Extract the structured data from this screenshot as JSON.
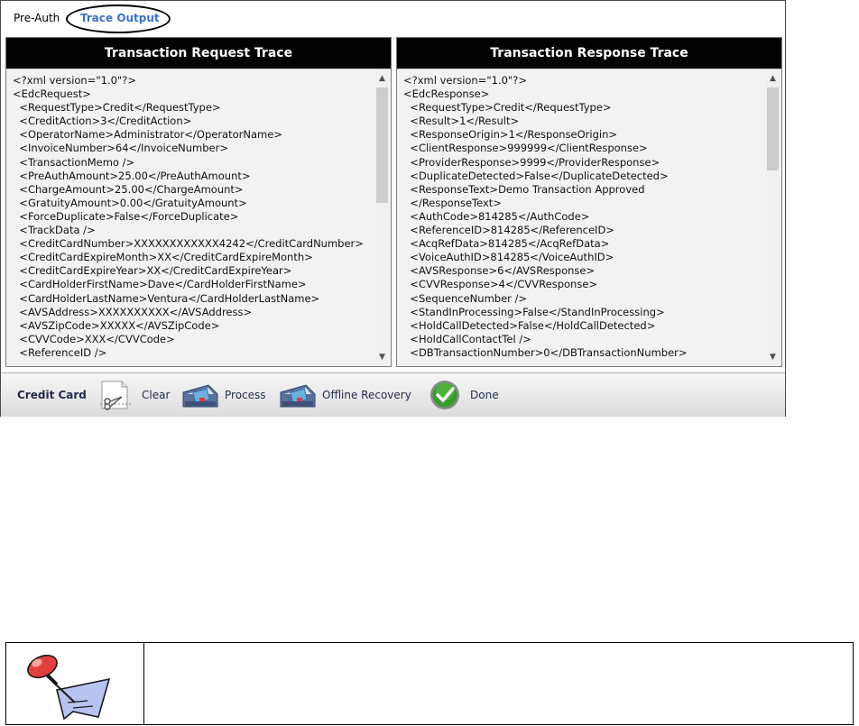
{
  "tabs": {
    "preauth": "Pre-Auth",
    "trace_output": "Trace Output"
  },
  "request_panel": {
    "title": "Transaction Request Trace",
    "text": "<?xml version=\"1.0\"?>\n<EdcRequest>\n  <RequestType>Credit</RequestType>\n  <CreditAction>3</CreditAction>\n  <OperatorName>Administrator</OperatorName>\n  <InvoiceNumber>64</InvoiceNumber>\n  <TransactionMemo />\n  <PreAuthAmount>25.00</PreAuthAmount>\n  <ChargeAmount>25.00</ChargeAmount>\n  <GratuityAmount>0.00</GratuityAmount>\n  <ForceDuplicate>False</ForceDuplicate>\n  <TrackData />\n  <CreditCardNumber>XXXXXXXXXXXX4242</CreditCardNumber>\n  <CreditCardExpireMonth>XX</CreditCardExpireMonth>\n  <CreditCardExpireYear>XX</CreditCardExpireYear>\n  <CardHolderFirstName>Dave</CardHolderFirstName>\n  <CardHolderLastName>Ventura</CardHolderLastName>\n  <AVSAddress>XXXXXXXXXX</AVSAddress>\n  <AVSZipCode>XXXXX</AVSZipCode>\n  <CVVCode>XXX</CVVCode>\n  <ReferenceID />"
  },
  "response_panel": {
    "title": "Transaction Response Trace",
    "text": "<?xml version=\"1.0\"?>\n<EdcResponse>\n  <RequestType>Credit</RequestType>\n  <Result>1</Result>\n  <ResponseOrigin>1</ResponseOrigin>\n  <ClientResponse>999999</ClientResponse>\n  <ProviderResponse>9999</ProviderResponse>\n  <DuplicateDetected>False</DuplicateDetected>\n  <ResponseText>Demo Transaction Approved\n  </ResponseText>\n  <AuthCode>814285</AuthCode>\n  <ReferenceID>814285</ReferenceID>\n  <AcqRefData>814285</AcqRefData>\n  <VoiceAuthID>814285</VoiceAuthID>\n  <AVSResponse>6</AVSResponse>\n  <CVVResponse>4</CVVResponse>\n  <SequenceNumber />\n  <StandInProcessing>False</StandInProcessing>\n  <HoldCallDetected>False</HoldCallDetected>\n  <HoldCallContactTel />\n  <DBTransactionNumber>0</DBTransactionNumber>"
  },
  "toolbar": {
    "title": "Credit Card",
    "clear": "Clear",
    "process": "Process",
    "offline_recovery": "Offline Recovery",
    "done": "Done"
  },
  "icons": {
    "clear": "scissors-icon",
    "process": "card-swipe-icon",
    "offline_recovery": "card-swipe-icon",
    "done": "checkmark-icon",
    "note": "pushpin-note-icon"
  },
  "colors": {
    "tab_active": "#3b73c9",
    "panel_header": "#000000",
    "done_green": "#3a9a2e"
  }
}
